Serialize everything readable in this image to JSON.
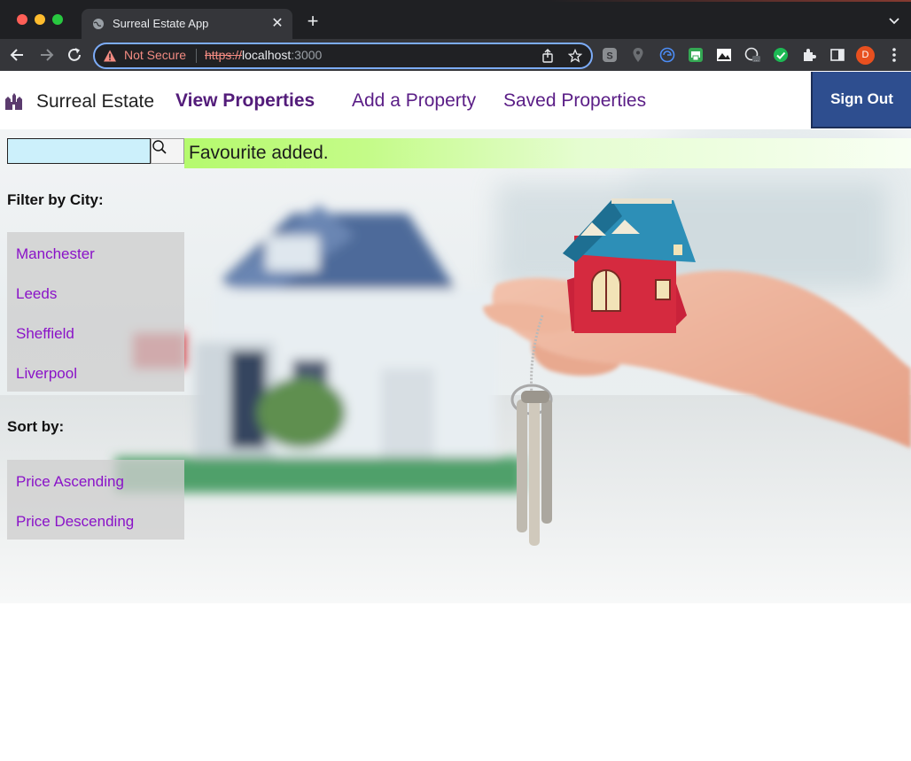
{
  "browser": {
    "tab_title": "Surreal Estate App",
    "tab_close": "✕",
    "new_tab": "+",
    "not_secure": "Not Secure",
    "url_scheme": "https://",
    "url_host": "localhost",
    "url_port": ":3000",
    "profile_initial": "D"
  },
  "nav": {
    "brand": "Surreal Estate",
    "links": [
      "View Properties",
      "Add a Property",
      "Saved Properties"
    ],
    "active_link": "View Properties",
    "sign_out": "Sign Out"
  },
  "search": {
    "value": "",
    "placeholder": ""
  },
  "flash_message": "Favourite added.",
  "filter": {
    "label": "Filter by City:",
    "cities": [
      "Manchester",
      "Leeds",
      "Sheffield",
      "Liverpool"
    ]
  },
  "sort": {
    "label": "Sort by:",
    "options": [
      "Price Ascending",
      "Price Descending"
    ]
  },
  "colors": {
    "link": "#8a12c8",
    "nav_link": "#5a1d86",
    "sign_out_bg": "#2e4e8f",
    "flash_bg": "#b5fa6e",
    "search_bg": "#ccf0fb"
  }
}
